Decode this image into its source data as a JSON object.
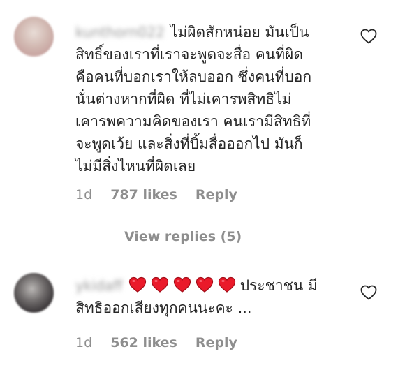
{
  "comments": [
    {
      "username": "kunthorn022",
      "text_lines": [
        "ไม่ผิดสักหน่อย มันเป็น",
        "สิทธิ์ของเราที่เราจะพูดจะสื่อ คนที่ผิด",
        "คือคนที่บอกเราให้ลบออก ซึ่งคนที่บอก",
        "นั่นต่างหากที่ผิด ที่ไม่เคารพสิทธิไม่",
        "เคารพความคิดของเรา คนเรามีสิทธิที่",
        "จะพูดเว้ย และสิ่งที่บิ้มสื่อออกไป มันก็",
        "ไม่มีสิ่งไหนที่ผิดเลย"
      ],
      "time": "1d",
      "likes": "787 likes",
      "reply_label": "Reply",
      "view_replies": "View replies (5)"
    },
    {
      "username": "ykidaff",
      "hearts": [
        "heart",
        "heart",
        "heart",
        "heart",
        "heart"
      ],
      "text_line1": "ประชาชน มี",
      "text_line2": "สิทธิออกเสียงทุกคนนะคะ ...",
      "time": "1d",
      "likes": "562 likes",
      "reply_label": "Reply"
    }
  ],
  "icons": {
    "like": "heart-outline-icon",
    "emoji": "red-heart-emoji"
  },
  "colors": {
    "text": "#262626",
    "secondary": "#8e8e8e",
    "heart_red": "#ea1a2a"
  }
}
